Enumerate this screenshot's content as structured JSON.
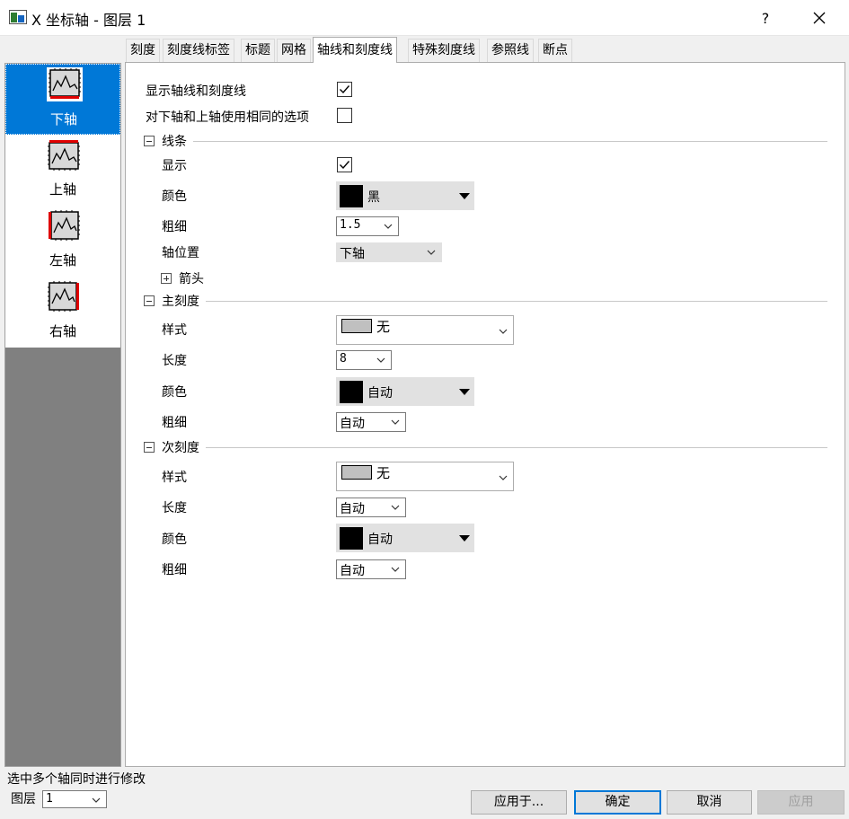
{
  "window": {
    "title": "X 坐标轴 - 图层 1",
    "help": "?"
  },
  "tabs": [
    {
      "label": "刻度"
    },
    {
      "label": "刻度线标签"
    },
    {
      "label": "标题"
    },
    {
      "label": "网格"
    },
    {
      "label": "轴线和刻度线",
      "active": true
    },
    {
      "label": "特殊刻度线"
    },
    {
      "label": "参照线"
    },
    {
      "label": "断点"
    }
  ],
  "axes": [
    {
      "label": "下轴",
      "selected": true
    },
    {
      "label": "上轴"
    },
    {
      "label": "左轴"
    },
    {
      "label": "右轴"
    }
  ],
  "options": {
    "show_axis_ticks": {
      "label": "显示轴线和刻度线",
      "checked": true
    },
    "same_options": {
      "label": "对下轴和上轴使用相同的选项",
      "checked": false
    }
  },
  "line": {
    "header": "线条",
    "show_label": "显示",
    "show_checked": true,
    "color_label": "颜色",
    "color_value": "黑",
    "color_hex": "#000000",
    "width_label": "粗细",
    "width_value": "1.5",
    "position_label": "轴位置",
    "position_value": "下轴",
    "arrow_header": "箭头"
  },
  "major": {
    "header": "主刻度",
    "style_label": "样式",
    "style_value": "无",
    "length_label": "长度",
    "length_value": "8",
    "color_label": "颜色",
    "color_value": "自动",
    "width_label": "粗细",
    "width_value": "自动"
  },
  "minor": {
    "header": "次刻度",
    "style_label": "样式",
    "style_value": "无",
    "length_label": "长度",
    "length_value": "自动",
    "color_label": "颜色",
    "color_value": "自动",
    "width_label": "粗细",
    "width_value": "自动"
  },
  "footer": {
    "status": "选中多个轴同时进行修改",
    "layer_label": "图层",
    "layer_value": "1",
    "apply_to": "应用于...",
    "ok": "确定",
    "cancel": "取消",
    "apply": "应用"
  }
}
